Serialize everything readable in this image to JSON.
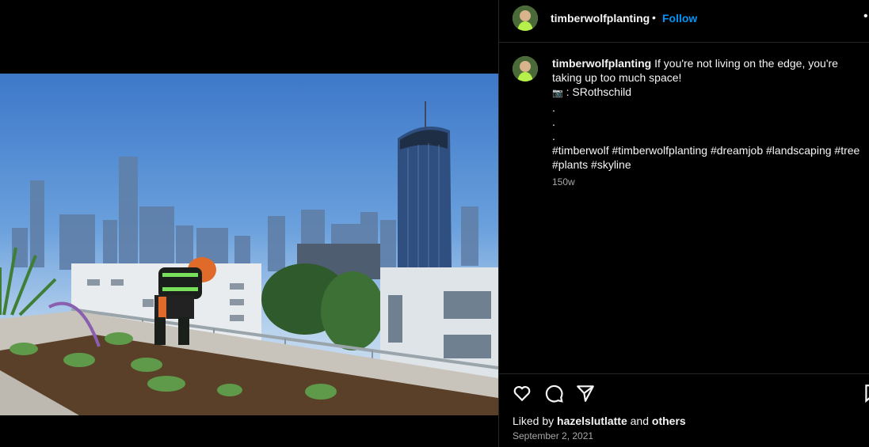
{
  "post": {
    "username": "timberwolfplanting",
    "follow_label": "Follow",
    "separator": "•",
    "more_label": "•"
  },
  "caption": {
    "username": "timberwolfplanting",
    "line1": "If you're not living on the edge, you're taking up too much space!",
    "camera_icon": "📷",
    "credit": ": SRothschild",
    "dot1": ".",
    "dot2": ".",
    "dot3": ".",
    "hashtags": "#timberwolf #timberwolfplanting #dreamjob #landscaping #tree #plants #skyline",
    "age": "150w"
  },
  "icons": {
    "like": "heart-icon",
    "comment": "comment-icon",
    "share": "share-icon",
    "save": "bookmark-icon"
  },
  "likes": {
    "prefix": "Liked by",
    "user": "hazelslutlatte",
    "joiner": "and",
    "others": "others"
  },
  "date": "September 2, 2021",
  "colors": {
    "background": "#000000",
    "follow": "#0095f6",
    "muted": "#a8a8a8",
    "divider": "#262626"
  }
}
